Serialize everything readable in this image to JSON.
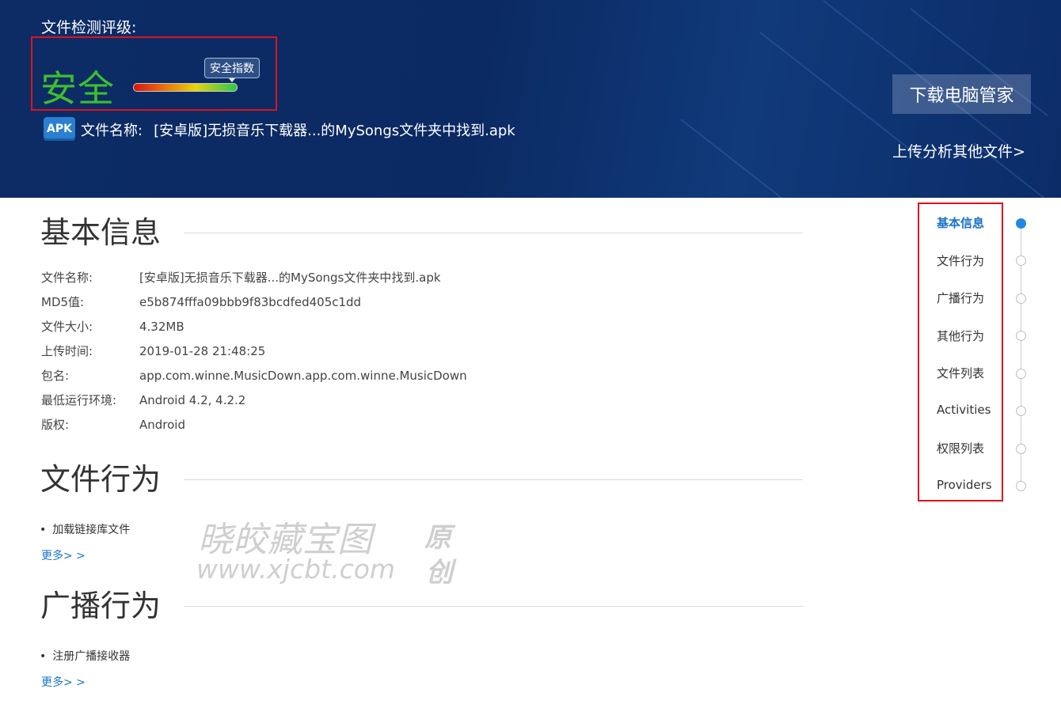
{
  "header": {
    "rating_label": "文件检测评级:",
    "rating_value": "安全",
    "index_tooltip": "安全指数",
    "file_name_label": "文件名称:",
    "file_name": "[安卓版]无损音乐下载器...的MySongs文件夹中找到.apk",
    "apk_icon_text": "APK",
    "download_button": "下载电脑管家",
    "upload_link": "上传分析其他文件>"
  },
  "basic_info": {
    "title": "基本信息",
    "rows": [
      {
        "key": "文件名称:",
        "value": "[安卓版]无损音乐下载器...的MySongs文件夹中找到.apk"
      },
      {
        "key": "MD5值:",
        "value": "e5b874fffa09bbb9f83bcdfed405c1dd"
      },
      {
        "key": "文件大小:",
        "value": "4.32MB"
      },
      {
        "key": "上传时间:",
        "value": "2019-01-28 21:48:25"
      },
      {
        "key": "包名:",
        "value": "app.com.winne.MusicDown.app.com.winne.MusicDown"
      },
      {
        "key": "最低运行环境:",
        "value": "Android 4.2, 4.2.2"
      },
      {
        "key": "版权:",
        "value": "Android"
      }
    ]
  },
  "file_behavior": {
    "title": "文件行为",
    "items": [
      "加载链接库文件"
    ],
    "more": "更多> >"
  },
  "broadcast_behavior": {
    "title": "广播行为",
    "items": [
      "注册广播接收器"
    ],
    "more": "更多> >"
  },
  "watermark": {
    "line1": "晓皎藏宝图",
    "line2": "www.xjcbt.com",
    "side1": "原",
    "side2": "创"
  },
  "side_nav": {
    "items": [
      "基本信息",
      "文件行为",
      "广播行为",
      "其他行为",
      "文件列表",
      "Activities",
      "权限列表",
      "Providers"
    ],
    "active_index": 0
  },
  "colors": {
    "banner": "#0d2c66",
    "safe_green": "#3fbf2c",
    "highlight_red": "#e0121b",
    "link_blue": "#1a73c8"
  }
}
